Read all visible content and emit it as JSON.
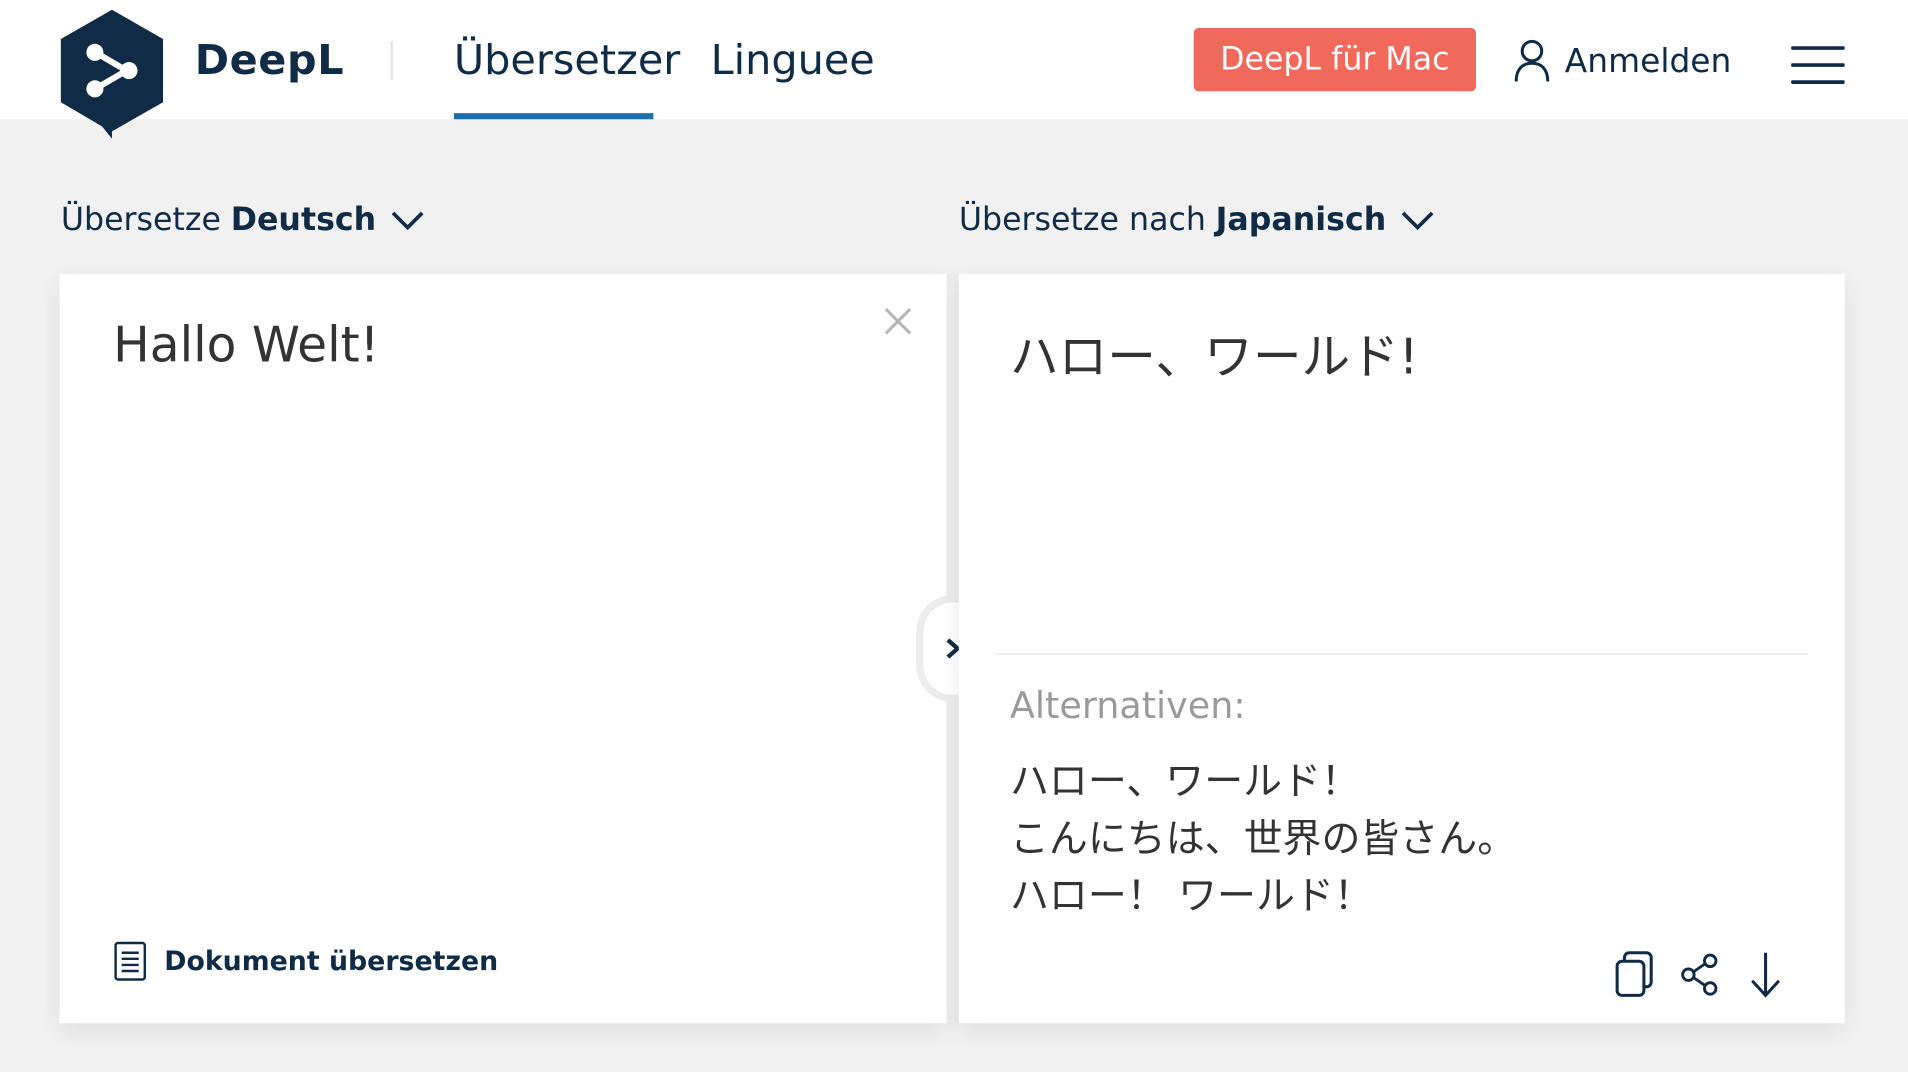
{
  "brand": {
    "logo_text": "DeepL",
    "colors": {
      "navy": "#0f2b46",
      "accent_blue": "#1c6fb0",
      "cta": "#f0695a",
      "background": "#f1f1f1"
    }
  },
  "header": {
    "tabs": [
      {
        "label": "Übersetzer",
        "active": true
      },
      {
        "label": "Linguee",
        "active": false
      }
    ],
    "cta_label": "DeepL für Mac",
    "login_label": "Anmelden",
    "menu_icon": "hamburger-menu-icon"
  },
  "source": {
    "prefix": "Übersetze",
    "language": "Deutsch",
    "text": "Hallo Welt!",
    "clear_icon": "close-icon",
    "document_link_label": "Dokument übersetzen",
    "document_icon": "document-icon"
  },
  "target": {
    "prefix": "Übersetze nach",
    "language": "Japanisch",
    "text": "ハロー、ワールド!",
    "alternatives_label": "Alternativen:",
    "alternatives": [
      "ハロー、ワールド！",
      "こんにちは、世界の皆さん。",
      "ハロー！ ワールド！"
    ],
    "action_icons": [
      "copy-icon",
      "share-icon",
      "download-icon"
    ]
  },
  "swap": {
    "icon": "chevron-right-icon"
  }
}
